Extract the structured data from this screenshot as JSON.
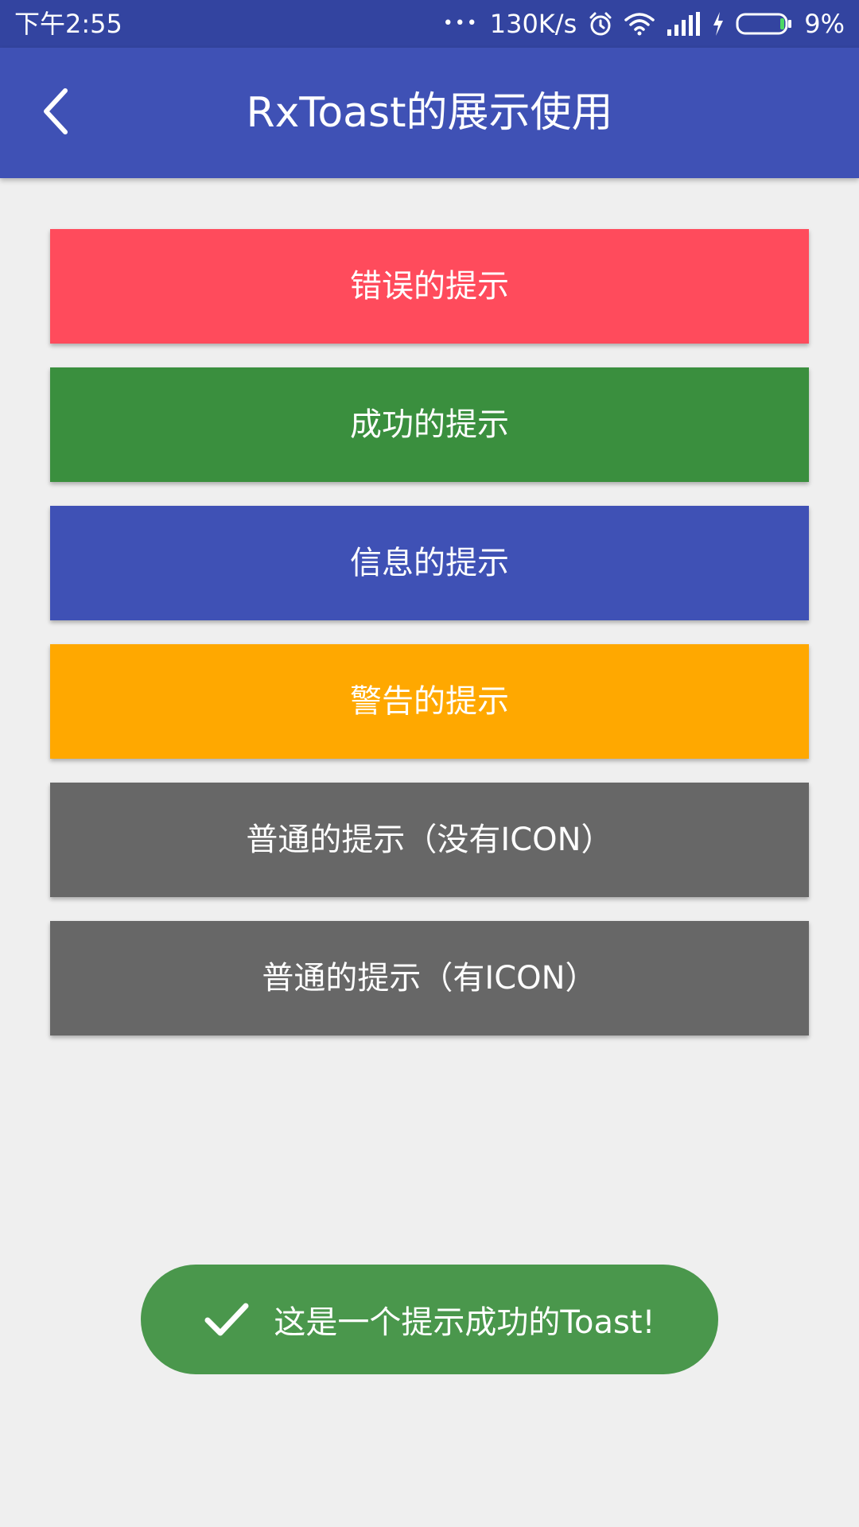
{
  "status_bar": {
    "time": "下午2:55",
    "more": "•••",
    "net_speed": "130K/s",
    "battery": "9%",
    "icons": [
      "alarm-icon",
      "wifi-icon",
      "signal-icon",
      "charging-icon",
      "battery-icon"
    ]
  },
  "app_bar": {
    "back_icon": "chevron-left-icon",
    "title": "RxToast的展示使用"
  },
  "buttons": [
    {
      "label": "错误的提示",
      "color": "#ff4b5c"
    },
    {
      "label": "成功的提示",
      "color": "#3a8f3e"
    },
    {
      "label": "信息的提示",
      "color": "#3f51b5"
    },
    {
      "label": "警告的提示",
      "color": "#ffa800"
    },
    {
      "label": "普通的提示（没有ICON）",
      "color": "#676767"
    },
    {
      "label": "普通的提示（有ICON）",
      "color": "#676767"
    }
  ],
  "toast": {
    "icon": "checkmark-icon",
    "message": "这是一个提示成功的Toast!",
    "color": "#4a974c"
  }
}
